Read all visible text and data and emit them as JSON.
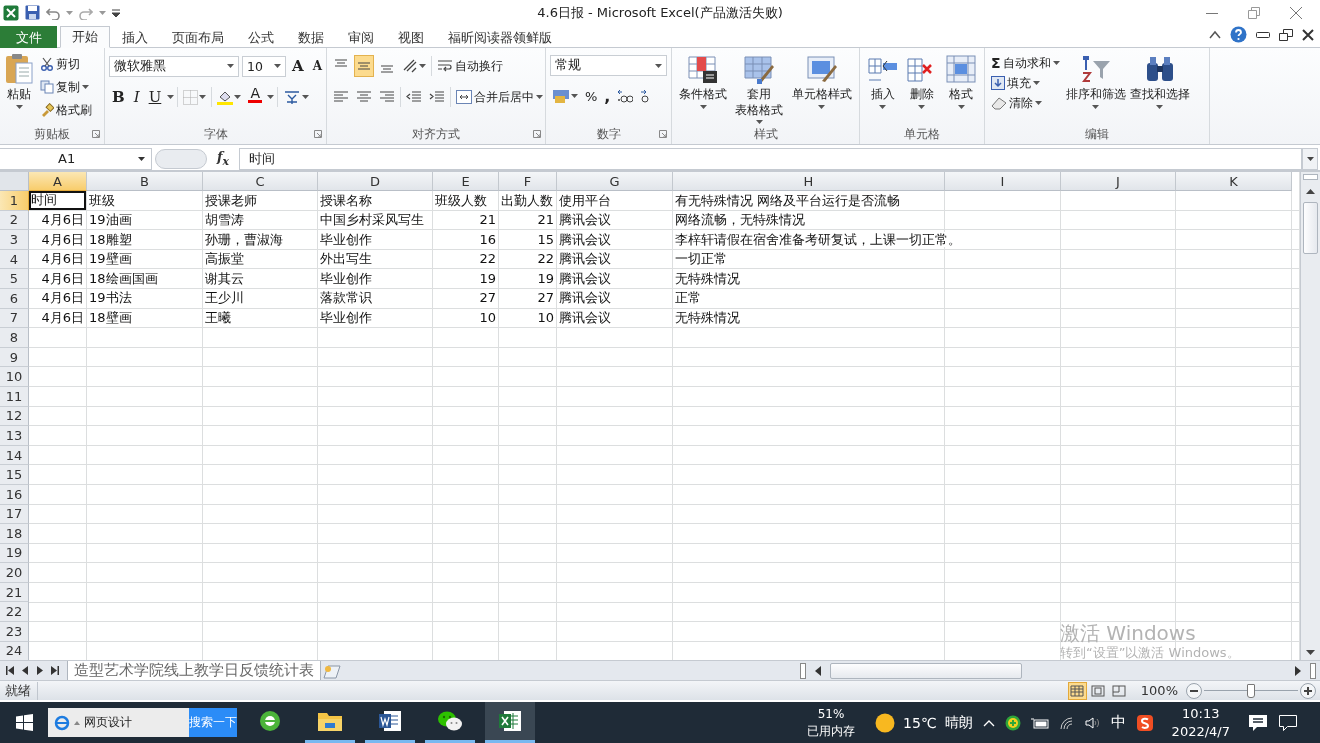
{
  "title_bar": {
    "title": "4.6日报 - Microsoft Excel(产品激活失败)"
  },
  "tabs": [
    {
      "label": "文件",
      "kind": "file",
      "selected": false
    },
    {
      "label": "开始",
      "kind": "tab",
      "selected": true
    },
    {
      "label": "插入",
      "kind": "tab",
      "selected": false
    },
    {
      "label": "页面布局",
      "kind": "tab",
      "selected": false
    },
    {
      "label": "公式",
      "kind": "tab",
      "selected": false
    },
    {
      "label": "数据",
      "kind": "tab",
      "selected": false
    },
    {
      "label": "审阅",
      "kind": "tab",
      "selected": false
    },
    {
      "label": "视图",
      "kind": "tab",
      "selected": false
    },
    {
      "label": "福昕阅读器领鲜版",
      "kind": "tab",
      "selected": false
    }
  ],
  "ribbon": {
    "groups": [
      {
        "kind": "clipboard",
        "label": "剪贴板",
        "launcher": true,
        "paste": "粘贴",
        "tools": [
          {
            "kind": "cut",
            "label": "剪切",
            "caret": false
          },
          {
            "kind": "copy",
            "label": "复制",
            "caret": true
          },
          {
            "kind": "painter",
            "label": "格式刷",
            "caret": false
          }
        ]
      },
      {
        "kind": "font",
        "label": "字体",
        "launcher": true,
        "font": "微软雅黑",
        "size": "10",
        "grow": "A",
        "shrink": "A",
        "bold": "B",
        "italic": "I",
        "underline": "U",
        "font_color": "A"
      },
      {
        "kind": "align",
        "label": "对齐方式",
        "launcher": true,
        "vertical": [
          {
            "selected": false
          },
          {
            "selected": true
          },
          {
            "selected": false
          }
        ],
        "wrap": "自动换行",
        "merge": "合并后居中"
      },
      {
        "kind": "number",
        "label": "数字",
        "launcher": true,
        "format": "常规",
        "percent": "%",
        "comma": ","
      },
      {
        "kind": "large",
        "label": "样式",
        "launcher": false,
        "buttons": [
          {
            "kind": "conditional",
            "lines": [
              "条件格式"
            ]
          },
          {
            "kind": "table",
            "lines": [
              "套用",
              "表格格式"
            ]
          },
          {
            "kind": "cellstyle",
            "lines": [
              "单元格样式"
            ]
          }
        ]
      },
      {
        "kind": "large",
        "label": "单元格",
        "launcher": false,
        "buttons": [
          {
            "kind": "insert",
            "lines": [
              "插入"
            ]
          },
          {
            "kind": "delete",
            "lines": [
              "删除"
            ]
          },
          {
            "kind": "format",
            "lines": [
              "格式"
            ]
          }
        ]
      },
      {
        "kind": "editing",
        "label": "编辑",
        "launcher": false,
        "tools": [
          {
            "kind": "sum",
            "symbol": "Σ",
            "label": "自动求和"
          },
          {
            "kind": "fill",
            "label": "填充"
          },
          {
            "kind": "clear",
            "label": "清除"
          }
        ],
        "buttons": [
          {
            "kind": "sort",
            "lines": [
              "排序和筛选"
            ]
          },
          {
            "kind": "find",
            "lines": [
              "查找和选择"
            ]
          }
        ]
      }
    ]
  },
  "formula_bar": {
    "name_box": "A1",
    "function_label": "f$_{x}$",
    "formula": "时间"
  },
  "sheet": {
    "columns": [
      {
        "label": "A",
        "right_aligned": true,
        "selected": true
      },
      {
        "label": "B",
        "right_aligned": false,
        "selected": false
      },
      {
        "label": "C",
        "right_aligned": false,
        "selected": false
      },
      {
        "label": "D",
        "right_aligned": false,
        "selected": false
      },
      {
        "label": "E",
        "right_aligned": true,
        "selected": false
      },
      {
        "label": "F",
        "right_aligned": true,
        "selected": false
      },
      {
        "label": "G",
        "right_aligned": false,
        "selected": false
      },
      {
        "label": "H",
        "right_aligned": false,
        "selected": false
      },
      {
        "label": "I",
        "selected": false
      },
      {
        "label": "J",
        "selected": false
      },
      {
        "label": "K",
        "selected": false
      }
    ],
    "rows": [
      {
        "number": "1",
        "kind": "header",
        "selected": true,
        "cells": [
          "时间",
          "班级",
          "授课老师",
          "授课名称",
          "班级人数",
          "出勤人数",
          "使用平台",
          "有无特殊情况 网络及平台运行是否流畅"
        ]
      },
      {
        "number": "2",
        "kind": "record",
        "selected": false,
        "cells": [
          "4月6日",
          "19油画",
          "胡雪涛",
          "中国乡村采风写生",
          "21",
          "21",
          "腾讯会议",
          "网络流畅，无特殊情况"
        ]
      },
      {
        "number": "3",
        "kind": "record",
        "selected": false,
        "cells": [
          "4月6日",
          "18雕塑",
          "孙珊，曹淑海",
          "毕业创作",
          "16",
          "15",
          "腾讯会议",
          "李梓轩请假在宿舍准备考研复试，上课一切正常。"
        ]
      },
      {
        "number": "4",
        "kind": "record",
        "selected": false,
        "cells": [
          "4月6日",
          "19壁画",
          "高振堂",
          "外出写生",
          "22",
          "22",
          "腾讯会议",
          "一切正常"
        ]
      },
      {
        "number": "5",
        "kind": "record",
        "selected": false,
        "cells": [
          "4月6日",
          "18绘画国画",
          "谢其云",
          "毕业创作",
          "19",
          "19",
          "腾讯会议",
          "无特殊情况"
        ]
      },
      {
        "number": "6",
        "kind": "record",
        "selected": false,
        "cells": [
          "4月6日",
          "19书法",
          "王少川",
          "落款常识",
          "27",
          "27",
          "腾讯会议",
          "正常"
        ]
      },
      {
        "number": "7",
        "kind": "record",
        "selected": false,
        "cells": [
          "4月6日",
          "18壁画",
          "王曦",
          "毕业创作",
          "10",
          "10",
          "腾讯会议",
          "无特殊情况"
        ]
      },
      {
        "number": "8",
        "kind": "empty",
        "selected": false
      },
      {
        "number": "9",
        "kind": "empty",
        "selected": false
      },
      {
        "number": "10",
        "kind": "empty",
        "selected": false
      },
      {
        "number": "11",
        "kind": "empty",
        "selected": false
      },
      {
        "number": "12",
        "kind": "empty",
        "selected": false
      },
      {
        "number": "13",
        "kind": "empty",
        "selected": false
      },
      {
        "number": "14",
        "kind": "empty",
        "selected": false
      },
      {
        "number": "15",
        "kind": "empty",
        "selected": false
      },
      {
        "number": "16",
        "kind": "empty",
        "selected": false
      },
      {
        "number": "17",
        "kind": "empty",
        "selected": false
      },
      {
        "number": "18",
        "kind": "empty",
        "selected": false
      },
      {
        "number": "19",
        "kind": "empty",
        "selected": false
      },
      {
        "number": "20",
        "kind": "empty",
        "selected": false
      },
      {
        "number": "21",
        "kind": "empty",
        "selected": false
      },
      {
        "number": "22",
        "kind": "empty",
        "selected": false
      },
      {
        "number": "23",
        "kind": "empty",
        "selected": false
      },
      {
        "number": "24",
        "kind": "empty",
        "selected": false
      }
    ]
  },
  "sheet_tabs": [
    {
      "label": "造型艺术学院线上教学日反馈统计表",
      "selected": true
    }
  ],
  "activation_notice": {
    "title": "激活 Windows",
    "text": "转到“设置”以激活 Windows。"
  },
  "status_bar": {
    "status": "就绪",
    "views": [
      {
        "selected": true
      },
      {
        "selected": false
      },
      {
        "selected": false
      }
    ],
    "zoom": "100%",
    "zoom_slider": {
      "level": 0.5
    }
  },
  "taskbar": {
    "search": {
      "value": "网页设计",
      "button": "搜索一下"
    },
    "apps": [
      {
        "kind": "browser",
        "running": false,
        "active": false
      },
      {
        "kind": "folder",
        "running": true,
        "active": false
      },
      {
        "kind": "word",
        "running": true,
        "active": false
      },
      {
        "kind": "wechat",
        "running": true,
        "active": false
      },
      {
        "kind": "excel",
        "running": true,
        "active": true
      }
    ],
    "memory": {
      "percent": "51%",
      "label": "已用内存"
    },
    "weather": {
      "temperature": "15℃",
      "condition": "晴朗"
    },
    "ime": "中",
    "clock": {
      "time": "10:13",
      "date": "2022/4/7"
    }
  }
}
